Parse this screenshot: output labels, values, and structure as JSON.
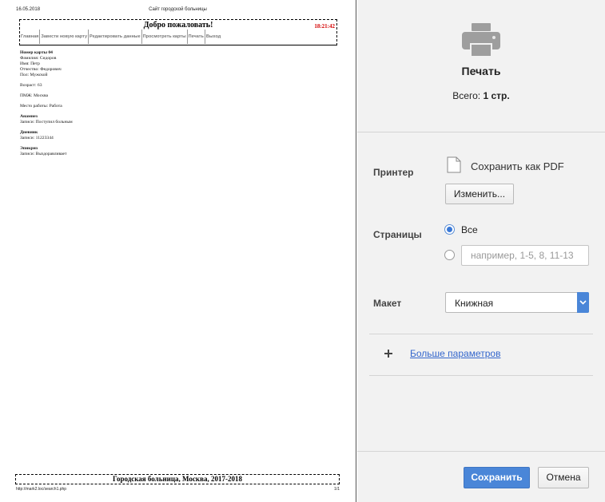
{
  "preview": {
    "header_date": "16.05.2018",
    "header_title": "Сайт городской больницы",
    "welcome": "Добро пожаловать!",
    "clock": "18:21:42",
    "nav": [
      "Главная",
      "Завести новую карту",
      "Редактировать данные",
      "Просмотреть карты",
      "Печать",
      "Выход"
    ],
    "card": {
      "number": "Номер карты 04",
      "surname": "Фамилия: Сидоров",
      "name": "Имя: Петр",
      "patronymic": "Отчество: Федорович",
      "sex": "Пол: Мужской",
      "age": "Возраст: 63",
      "residence": "ПМЖ: Москва",
      "work": "Место работы: Работа",
      "anamnesis_title": "Анамнез",
      "anamnesis_text": "Записи: Поступил больным",
      "diary_title": "Дневник",
      "diary_text": "Записи: 11223344",
      "epicrisis_title": "Эпикриз",
      "epicrisis_text": "Записи: Выздоравливает"
    },
    "footer": "Городская больница, Москва, 2017-2018",
    "url": "http://mark2.loc/search1.php",
    "page_num": "1/1"
  },
  "panel": {
    "title": "Печать",
    "total_label": "Всего:",
    "total_value": "1 стр.",
    "printer_label": "Принтер",
    "destination": "Сохранить как PDF",
    "change_button": "Изменить...",
    "pages_label": "Страницы",
    "pages_all": "Все",
    "pages_placeholder": "например, 1-5, 8, 11-13",
    "layout_label": "Макет",
    "layout_value": "Книжная",
    "more_settings": "Больше параметров",
    "save_button": "Сохранить",
    "cancel_button": "Отмена"
  },
  "colors": {
    "accent": "#4a86d8",
    "clock": "#d40000",
    "panel_bg": "#f2f2f2",
    "link": "#3366cc"
  }
}
